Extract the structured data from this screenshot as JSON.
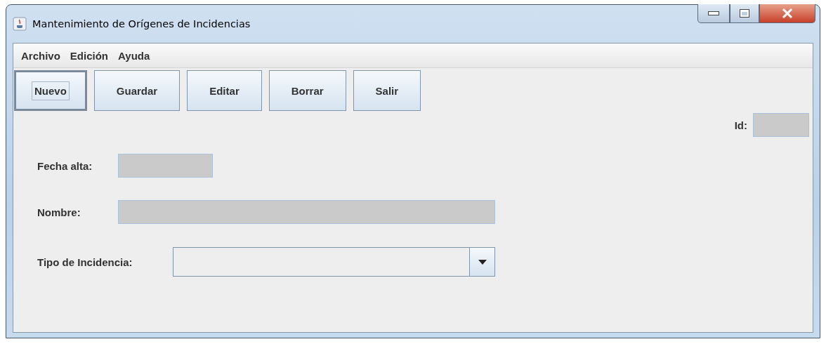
{
  "window": {
    "title": "Mantenimiento de Orígenes de Incidencias"
  },
  "menu": [
    "Archivo",
    "Edición",
    "Ayuda"
  ],
  "toolbar": [
    {
      "label": "Nuevo",
      "focused": true
    },
    {
      "label": "Guardar",
      "focused": false
    },
    {
      "label": "Editar",
      "focused": false
    },
    {
      "label": "Borrar",
      "focused": false
    },
    {
      "label": "Salir",
      "focused": false
    }
  ],
  "id_field": {
    "label": "Id:",
    "disabled": true
  },
  "form": [
    {
      "kind": "date",
      "label": "Fecha alta:",
      "disabled": true
    },
    {
      "kind": "text",
      "label": "Nombre:",
      "disabled": true
    },
    {
      "kind": "combo",
      "label": "Tipo de Incidencia:",
      "disabled": false
    }
  ]
}
